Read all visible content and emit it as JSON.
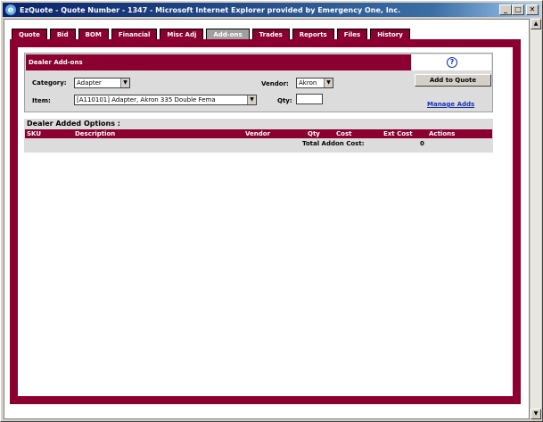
{
  "window": {
    "title": "EzQuote - Quote Number - 1347 - Microsoft Internet Explorer provided by Emergency One, Inc.",
    "icon": "ie-icon",
    "buttons": {
      "minimize": "_",
      "maximize": "□",
      "close": "✕"
    }
  },
  "tabs": [
    {
      "label": "Quote",
      "active": false
    },
    {
      "label": "Bid",
      "active": false
    },
    {
      "label": "BOM",
      "active": false
    },
    {
      "label": "Financial",
      "active": false
    },
    {
      "label": "Misc Adj",
      "active": false
    },
    {
      "label": "Add-ons",
      "active": true
    },
    {
      "label": "Trades",
      "active": false
    },
    {
      "label": "Reports",
      "active": false
    },
    {
      "label": "Files",
      "active": false
    },
    {
      "label": "History",
      "active": false
    }
  ],
  "dealer": {
    "header": "Dealer Add-ons",
    "help_icon": "?",
    "category_label": "Category:",
    "category_value": "Adapter",
    "vendor_label": "Vendor:",
    "vendor_value": "Akron",
    "item_label": "Item:",
    "item_value": "[A110101] Adapter, Akron 335 Double Fema",
    "qty_label": "Qty:",
    "qty_value": "",
    "add_button": "Add to Quote",
    "manage_link": "Manage Adds"
  },
  "options": {
    "title": "Dealer Added Options :",
    "columns": [
      "SKU",
      "Description",
      "Vendor",
      "Qty",
      "Cost",
      "Ext Cost",
      "Actions"
    ],
    "total_label": "Total Addon Cost:",
    "total_value": "0"
  },
  "colors": {
    "accent": "#8b0030",
    "tab_active": "#a0a0a0",
    "link": "#1530b0"
  }
}
